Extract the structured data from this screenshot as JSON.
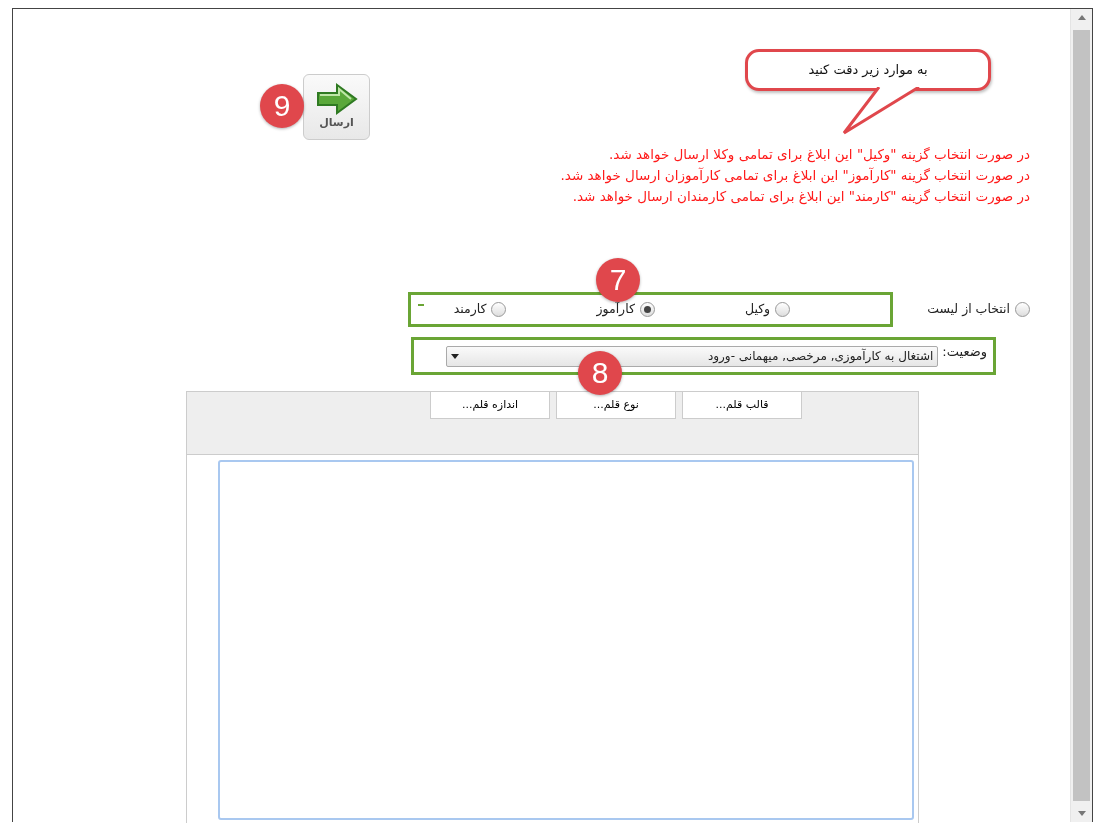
{
  "callout": {
    "text": "به موارد زیر دقت کنید"
  },
  "send_button": {
    "label": "ارسال",
    "marker": "9"
  },
  "notes": [
    "در صورت انتخاب گزینه \"وکیل\" این ابلاغ برای تمامی  وکلا ارسال خواهد شد.",
    "در صورت انتخاب گزینه \"کارآموز\" این ابلاغ برای تمامی  کارآموزان ارسال خواهد شد.",
    "در صورت انتخاب گزینه \"کارمند\" این ابلاغ برای تمامی  کارمندان ارسال خواهد شد."
  ],
  "list_option": {
    "label": "انتخاب از لیست",
    "selected": false
  },
  "recipient_group": {
    "marker": "7",
    "options": [
      {
        "label": "وکیل",
        "selected": false
      },
      {
        "label": "کارآموز",
        "selected": true
      },
      {
        "label": "کارمند",
        "selected": false
      }
    ]
  },
  "status": {
    "label": "وضعیت:",
    "value": "اشتغال به کارآموزی, مرخصی, میهمانی -ورود",
    "marker": "8"
  },
  "editor": {
    "toolbar": [
      "قالب قلم...",
      "نوع قلم...",
      "اندازه قلم..."
    ]
  }
}
